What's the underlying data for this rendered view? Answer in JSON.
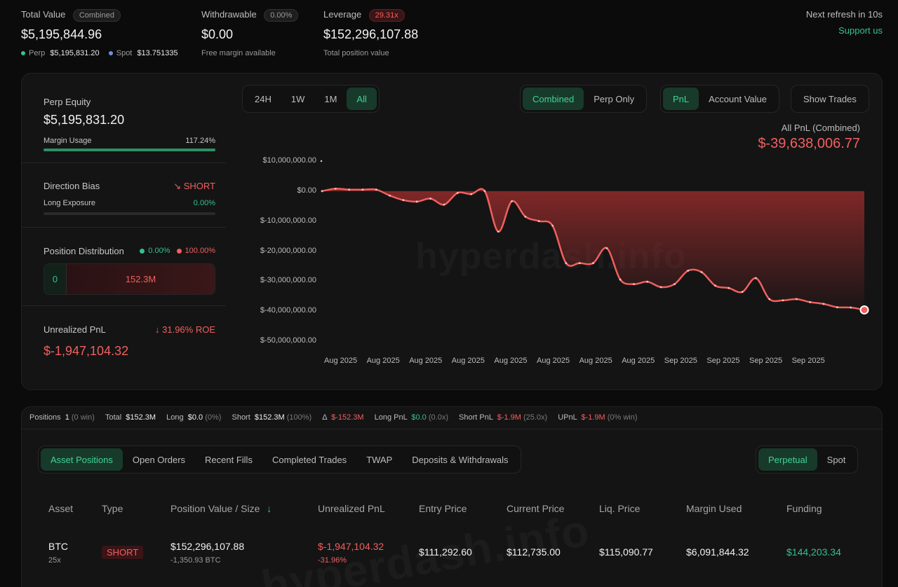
{
  "header": {
    "total_value": {
      "label": "Total Value",
      "badge": "Combined",
      "value": "$5,195,844.96",
      "perp_label": "Perp",
      "perp_value": "$5,195,831.20",
      "spot_label": "Spot",
      "spot_value": "$13.751335"
    },
    "withdrawable": {
      "label": "Withdrawable",
      "badge": "0.00%",
      "value": "$0.00",
      "sub": "Free margin available"
    },
    "leverage": {
      "label": "Leverage",
      "badge": "29.31x",
      "value": "$152,296,107.88",
      "sub": "Total position value"
    },
    "refresh": "Next refresh in 10s",
    "support": "Support us"
  },
  "left_panel": {
    "perp_equity": {
      "label": "Perp Equity",
      "value": "$5,195,831.20",
      "margin_label": "Margin Usage",
      "margin_value": "117.24%",
      "margin_fill": 1.0
    },
    "direction": {
      "label": "Direction Bias",
      "bias": "SHORT",
      "exposure_label": "Long Exposure",
      "exposure_value": "0.00%",
      "exposure_fill": 0.0
    },
    "distribution": {
      "label": "Position Distribution",
      "long_pct": "0.00%",
      "short_pct": "100.00%",
      "long_value": "0",
      "short_value": "152.3M"
    },
    "unrealized": {
      "label": "Unrealized PnL",
      "roe": "31.96% ROE",
      "value": "$-1,947,104.32"
    }
  },
  "controls": {
    "ranges": [
      "24H",
      "1W",
      "1M",
      "All"
    ],
    "range_active": 3,
    "modes": [
      "Combined",
      "Perp Only"
    ],
    "mode_active": 0,
    "metrics": [
      "PnL",
      "Account Value"
    ],
    "metric_active": 0,
    "show_trades": "Show Trades"
  },
  "chart_data": {
    "type": "area",
    "title": "All PnL (Combined)",
    "headline": "$-39,638,006.77",
    "ylabels": [
      "$10,000,000.00",
      "$0.00",
      "$-10,000,000.00",
      "$-20,000,000.00",
      "$-30,000,000.00",
      "$-40,000,000.00",
      "$-50,000,000.00"
    ],
    "ylim": [
      -50000000,
      10000000
    ],
    "xlabels": [
      "Aug 2025",
      "Aug 2025",
      "Aug 2025",
      "Aug 2025",
      "Aug 2025",
      "Aug 2025",
      "Aug 2025",
      "Aug 2025",
      "Sep 2025",
      "Sep 2025",
      "Sep 2025",
      "Sep 2025"
    ],
    "series": [
      {
        "values": [
          0,
          800000,
          500000,
          500000,
          500000,
          -1500000,
          -3000000,
          -3500000,
          -2500000,
          -4500000,
          -600000,
          -1000000,
          0,
          -13500000,
          -3400000,
          -8500000,
          -10000000,
          -11500000,
          -24000000,
          -24000000,
          -24000000,
          -19000000,
          -29500000,
          -31000000,
          -30200000,
          -32000000,
          -31000000,
          -26500000,
          -27000000,
          -31500000,
          -32300000,
          -33600000,
          -29000000,
          -36000000,
          -36400000,
          -36000000,
          -37000000,
          -37600000,
          -38700000,
          -38800000,
          -39600000
        ]
      }
    ],
    "line_color": "#f0605d",
    "fill_color": "#8e2a2a",
    "watermark": "hyperdash.info"
  },
  "stats": {
    "positions_label": "Positions",
    "positions": "1",
    "positions_note": "(0 win)",
    "total_label": "Total",
    "total": "$152.3M",
    "long_label": "Long",
    "long": "$0.0",
    "long_note": "(0%)",
    "short_label": "Short",
    "short": "$152.3M",
    "short_note": "(100%)",
    "delta_label": "Δ",
    "delta": "$-152.3M",
    "longpnl_label": "Long PnL",
    "longpnl": "$0.0",
    "longpnl_note": "(0.0x)",
    "shortpnl_label": "Short PnL",
    "shortpnl": "$-1.9M",
    "shortpnl_note": "(25.0x)",
    "upnl_label": "UPnL",
    "upnl": "$-1.9M",
    "upnl_note": "(0% win)"
  },
  "tabs": [
    "Asset Positions",
    "Open Orders",
    "Recent Fills",
    "Completed Trades",
    "TWAP",
    "Deposits & Withdrawals"
  ],
  "tab_active": 0,
  "market_tabs": [
    "Perpetual",
    "Spot"
  ],
  "table": {
    "headers": [
      "Asset",
      "Type",
      "Position Value / Size",
      "Unrealized PnL",
      "Entry Price",
      "Current Price",
      "Liq. Price",
      "Margin Used",
      "Funding"
    ],
    "row": {
      "asset": "BTC",
      "leverage": "25x",
      "type": "SHORT",
      "value": "$152,296,107.88",
      "size": "-1,350.93 BTC",
      "upnl": "$-1,947,104.32",
      "upnl_pct": "-31.96%",
      "entry": "$111,292.60",
      "current": "$112,735.00",
      "liq": "$115,090.77",
      "margin": "$6,091,844.32",
      "funding": "$144,203.34"
    }
  }
}
